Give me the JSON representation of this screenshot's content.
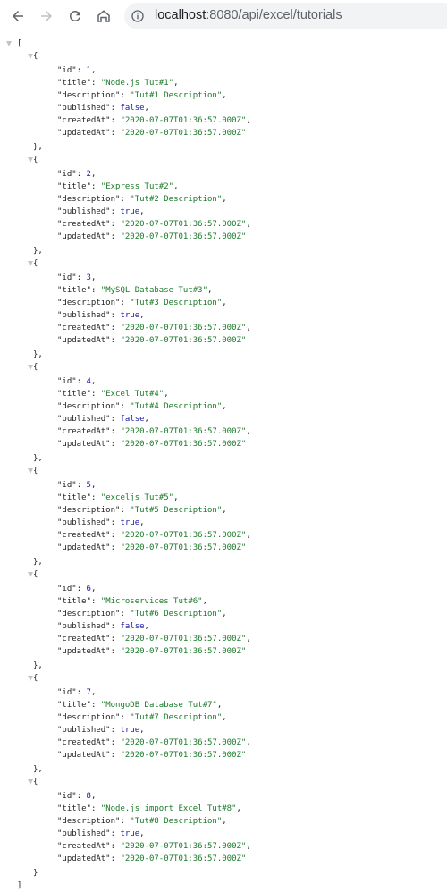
{
  "browser": {
    "url_host": "localhost",
    "url_rest": ":8080/api/excel/tutorials"
  },
  "keys": {
    "id": "\"id\"",
    "title": "\"title\"",
    "description": "\"description\"",
    "published": "\"published\"",
    "createdAt": "\"createdAt\"",
    "updatedAt": "\"updatedAt\""
  },
  "tutorials": [
    {
      "id": "1",
      "title": "\"Node.js Tut#1\"",
      "description": "\"Tut#1 Description\"",
      "published": "false",
      "createdAt": "\"2020-07-07T01:36:57.000Z\"",
      "updatedAt": "\"2020-07-07T01:36:57.000Z\""
    },
    {
      "id": "2",
      "title": "\"Express Tut#2\"",
      "description": "\"Tut#2 Description\"",
      "published": "true",
      "createdAt": "\"2020-07-07T01:36:57.000Z\"",
      "updatedAt": "\"2020-07-07T01:36:57.000Z\""
    },
    {
      "id": "3",
      "title": "\"MySQL Database Tut#3\"",
      "description": "\"Tut#3 Description\"",
      "published": "true",
      "createdAt": "\"2020-07-07T01:36:57.000Z\"",
      "updatedAt": "\"2020-07-07T01:36:57.000Z\""
    },
    {
      "id": "4",
      "title": "\"Excel Tut#4\"",
      "description": "\"Tut#4 Description\"",
      "published": "false",
      "createdAt": "\"2020-07-07T01:36:57.000Z\"",
      "updatedAt": "\"2020-07-07T01:36:57.000Z\""
    },
    {
      "id": "5",
      "title": "\"exceljs Tut#5\"",
      "description": "\"Tut#5 Description\"",
      "published": "true",
      "createdAt": "\"2020-07-07T01:36:57.000Z\"",
      "updatedAt": "\"2020-07-07T01:36:57.000Z\""
    },
    {
      "id": "6",
      "title": "\"Microservices Tut#6\"",
      "description": "\"Tut#6 Description\"",
      "published": "false",
      "createdAt": "\"2020-07-07T01:36:57.000Z\"",
      "updatedAt": "\"2020-07-07T01:36:57.000Z\""
    },
    {
      "id": "7",
      "title": "\"MongoDB Database Tut#7\"",
      "description": "\"Tut#7 Description\"",
      "published": "true",
      "createdAt": "\"2020-07-07T01:36:57.000Z\"",
      "updatedAt": "\"2020-07-07T01:36:57.000Z\""
    },
    {
      "id": "8",
      "title": "\"Node.js import Excel Tut#8\"",
      "description": "\"Tut#8 Description\"",
      "published": "true",
      "createdAt": "\"2020-07-07T01:36:57.000Z\"",
      "updatedAt": "\"2020-07-07T01:36:57.000Z\""
    }
  ]
}
